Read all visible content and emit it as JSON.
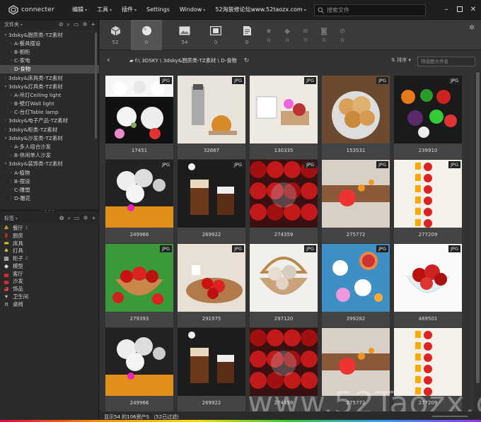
{
  "app": {
    "name": "connecter"
  },
  "menu": [
    "编辑",
    "工具",
    "插件",
    "Settings",
    "Window",
    "52淘装修论坛www.52taozx.com"
  ],
  "menu_caret": "▾",
  "search": {
    "placeholder": "搜索文件"
  },
  "sidebar": {
    "files_title": "文件夹",
    "tree": [
      {
        "label": "3dsky&厨房类-TZ素材",
        "level": 0,
        "arrow": "▾"
      },
      {
        "label": "A-餐具摆设",
        "level": 1,
        "arrow": "›"
      },
      {
        "label": "B-橱柜",
        "level": 1,
        "arrow": "›"
      },
      {
        "label": "C-家电",
        "level": 1,
        "arrow": "›"
      },
      {
        "label": "D-食物",
        "level": 1,
        "arrow": "›",
        "selected": true
      },
      {
        "label": "3dsky&床具类-TZ素材",
        "level": 0,
        "arrow": "›"
      },
      {
        "label": "3dsky&灯具类-TZ素材",
        "level": 0,
        "arrow": "▾"
      },
      {
        "label": "A-吊灯Ceiling light",
        "level": 1,
        "arrow": "›"
      },
      {
        "label": "B-壁灯Wall light",
        "level": 1,
        "arrow": "›"
      },
      {
        "label": "C-台灯Table lamp",
        "level": 1,
        "arrow": "›"
      },
      {
        "label": "3dsky&电子产品-TZ素材",
        "level": 0,
        "arrow": "›"
      },
      {
        "label": "3dsky&柜类-TZ素材",
        "level": 0,
        "arrow": "›"
      },
      {
        "label": "3dsky&沙发类-TZ素材",
        "level": 0,
        "arrow": "▾"
      },
      {
        "label": "A-多人组合沙发",
        "level": 1,
        "arrow": "›"
      },
      {
        "label": "B-休闲单人沙发",
        "level": 1,
        "arrow": "›"
      },
      {
        "label": "3dsky&装饰类-TZ素材",
        "level": 0,
        "arrow": "▾"
      },
      {
        "label": "A-植物",
        "level": 1,
        "arrow": "›"
      },
      {
        "label": "B-摆设",
        "level": 1,
        "arrow": "›"
      },
      {
        "label": "C-雕塑",
        "level": 1,
        "arrow": "›"
      },
      {
        "label": "D-雕花",
        "level": 1,
        "arrow": "›"
      }
    ],
    "tags_title": "标签",
    "tags": [
      {
        "label": "餐厅",
        "count": "1",
        "icon": "chair-icon",
        "color": "#d8a42b"
      },
      {
        "label": "厨房",
        "count": "",
        "icon": "chef-icon",
        "color": "#c0392b"
      },
      {
        "label": "床具",
        "count": "",
        "icon": "bed-icon",
        "color": "#e6b830"
      },
      {
        "label": "灯具",
        "count": "",
        "icon": "lamp-icon",
        "color": "#e0c040"
      },
      {
        "label": "柜子",
        "count": "2",
        "icon": "cabinet-icon",
        "color": "#ccc"
      },
      {
        "label": "模型",
        "count": "",
        "icon": "tag-icon",
        "color": "#ddd"
      },
      {
        "label": "客厅",
        "count": "",
        "icon": "sofa-icon",
        "color": "#d03030"
      },
      {
        "label": "沙发",
        "count": "",
        "icon": "sofa-icon",
        "color": "#d03030"
      },
      {
        "label": "饰品",
        "count": "",
        "icon": "pacman-icon",
        "color": "#e04060"
      },
      {
        "label": "卫生间",
        "count": "",
        "icon": "toilet-icon",
        "color": "#ccc"
      },
      {
        "label": "桌椅",
        "count": "",
        "icon": "table-icon",
        "color": "#ccc"
      }
    ]
  },
  "toolbar": {
    "items": [
      {
        "name": "3d-model",
        "count": "52"
      },
      {
        "name": "material",
        "count": "0"
      },
      {
        "name": "image",
        "count": "54"
      },
      {
        "name": "video",
        "count": "0"
      },
      {
        "name": "document",
        "count": "0"
      }
    ],
    "filters": [
      {
        "name": "star",
        "count": "0"
      },
      {
        "name": "tag",
        "count": "0"
      },
      {
        "name": "list",
        "count": "0"
      },
      {
        "name": "camera",
        "count": "0"
      },
      {
        "name": "block",
        "count": "0"
      }
    ]
  },
  "path": "f:\\ 3DSKY \\ 3dsky&厨房类-TZ素材 \\ D-食物",
  "sort": "排序",
  "filter_placeholder": "筛选图文件名",
  "cards": [
    {
      "label": "17451",
      "badge": "JPG",
      "art": "plates"
    },
    {
      "label": "32667",
      "badge": "JPG",
      "art": "coffee"
    },
    {
      "label": "130335",
      "badge": "JPG",
      "art": "kitchen"
    },
    {
      "label": "153531",
      "badge": "JPG",
      "art": "bread"
    },
    {
      "label": "239910",
      "badge": "JPG",
      "art": "veg"
    },
    {
      "label": "249966",
      "badge": "JPG",
      "art": "eggs"
    },
    {
      "label": "269922",
      "badge": "JPG",
      "art": "latte"
    },
    {
      "label": "274359",
      "badge": "JPG",
      "art": "apples"
    },
    {
      "label": "275772",
      "badge": "JPG",
      "art": "board"
    },
    {
      "label": "277209",
      "badge": "JPG",
      "art": "strip"
    },
    {
      "label": "279393",
      "badge": "JPG",
      "art": "basket"
    },
    {
      "label": "291975",
      "badge": "JPG",
      "art": "tray"
    },
    {
      "label": "297120",
      "badge": "JPG",
      "art": "mushroom"
    },
    {
      "label": "399282",
      "badge": "JPG",
      "art": "breakfast"
    },
    {
      "label": "469501",
      "badge": "JPG",
      "art": "bowl"
    },
    {
      "label": "249966",
      "badge": "",
      "art": "eggs"
    },
    {
      "label": "269922",
      "badge": "",
      "art": "latte"
    },
    {
      "label": "274359",
      "badge": "",
      "art": "apples"
    },
    {
      "label": "275772",
      "badge": "",
      "art": "board"
    },
    {
      "label": "277209",
      "badge": "",
      "art": "strip"
    }
  ],
  "status": "显示54 的106资产S （52已过滤）",
  "watermark": "www.52Taozx.com"
}
